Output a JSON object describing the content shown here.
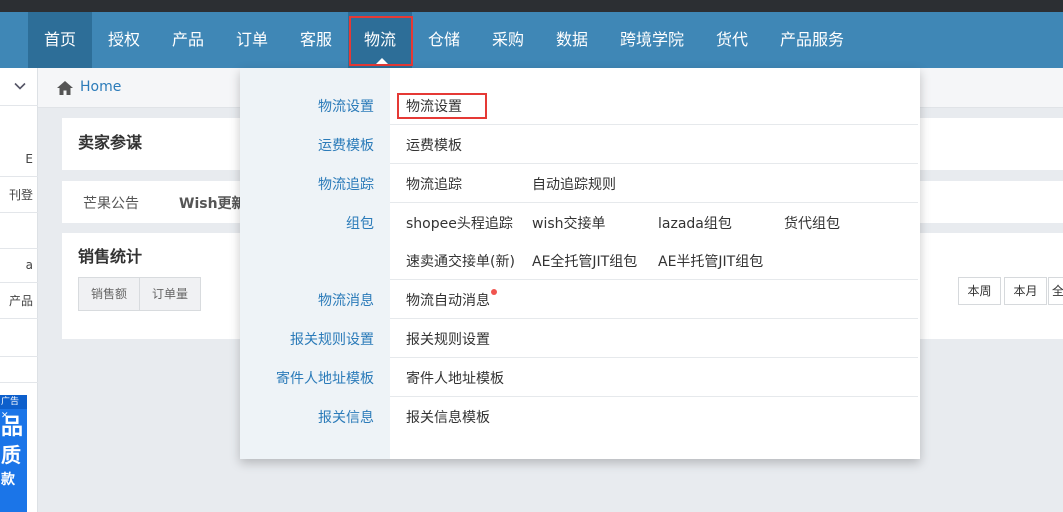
{
  "nav": {
    "items": [
      {
        "label": "首页"
      },
      {
        "label": "授权"
      },
      {
        "label": "产品"
      },
      {
        "label": "订单"
      },
      {
        "label": "客服"
      },
      {
        "label": "物流"
      },
      {
        "label": "仓储"
      },
      {
        "label": "采购"
      },
      {
        "label": "数据"
      },
      {
        "label": "跨境学院"
      },
      {
        "label": "货代"
      },
      {
        "label": "产品服务"
      }
    ],
    "active": "物流"
  },
  "breadcrumb": {
    "home_label": "Home"
  },
  "sidebar": {
    "fragments": [
      "E",
      "刊登",
      "a",
      "产品"
    ],
    "ad": {
      "label": "广告",
      "glyph1": "品",
      "glyph2": "质",
      "glyph3": "款"
    }
  },
  "cards": {
    "seller_title": "卖家参谋",
    "tabs": [
      "芒果公告",
      "Wish更新"
    ],
    "sales_title": "销售统计",
    "metrics": [
      "销售额",
      "订单量"
    ],
    "ranges": [
      "本周",
      "本月",
      "全"
    ]
  },
  "mega_menu": {
    "categories": [
      {
        "label": "物流设置",
        "links": [
          "物流设置"
        ]
      },
      {
        "label": "运费模板",
        "links": [
          "运费模板"
        ]
      },
      {
        "label": "物流追踪",
        "links": [
          "物流追踪",
          "自动追踪规则"
        ]
      },
      {
        "label": "组包",
        "links": [
          "shopee头程追踪",
          "wish交接单",
          "lazada组包",
          "货代组包"
        ]
      },
      {
        "label": "",
        "links": [
          "速卖通交接单(新)",
          "AE全托管JIT组包",
          "AE半托管JIT组包"
        ]
      },
      {
        "label": "物流消息",
        "links": [
          "物流自动消息"
        ]
      },
      {
        "label": "报关规则设置",
        "links": [
          "报关规则设置"
        ]
      },
      {
        "label": "寄件人地址模板",
        "links": [
          "寄件人地址模板"
        ]
      },
      {
        "label": "报关信息",
        "links": [
          "报关信息模板"
        ]
      }
    ]
  },
  "colors": {
    "nav_bg": "#3f87b6",
    "nav_active_bg": "#2d6e98",
    "link_blue": "#2b7bb9",
    "highlight_red": "#e53935"
  }
}
